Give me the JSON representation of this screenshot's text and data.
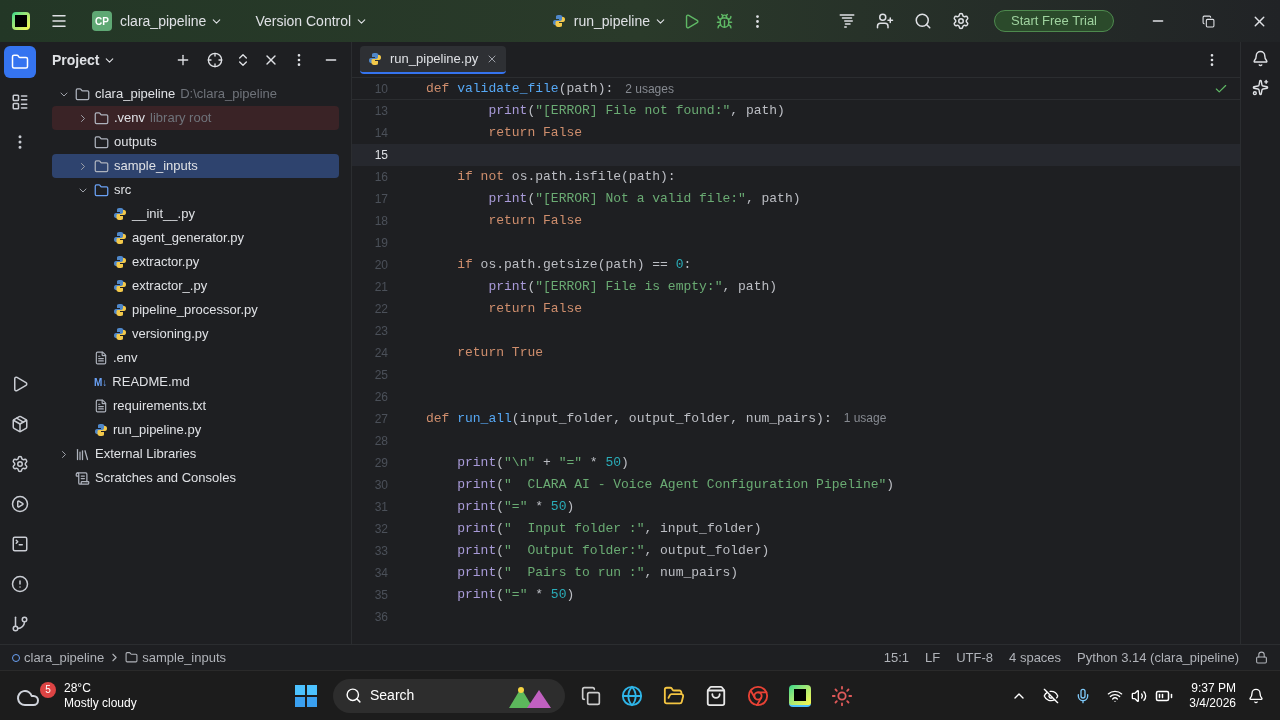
{
  "titlebar": {
    "project_badge": "CP",
    "project": "clara_pipeline",
    "vcs": "Version Control",
    "run_config": "run_pipeline",
    "trial_button": "Start Free Trial"
  },
  "project_panel": {
    "title": "Project",
    "tree": [
      {
        "name": "clara_pipeline",
        "kind": "folder",
        "hint": "D:\\clara_pipeline",
        "expanded": true,
        "selected": false,
        "children": [
          {
            "name": ".venv",
            "kind": "folder",
            "hint": "library root",
            "expanded": false,
            "selected": false,
            "excluded": true
          },
          {
            "name": "outputs",
            "kind": "folder",
            "selected": false
          },
          {
            "name": "sample_inputs",
            "kind": "folder",
            "expanded": false,
            "selected": true
          },
          {
            "name": "src",
            "kind": "source",
            "expanded": true,
            "selected": false,
            "children": [
              {
                "name": "__init__.py",
                "kind": "python",
                "selected": false
              },
              {
                "name": "agent_generator.py",
                "kind": "python",
                "selected": false
              },
              {
                "name": "extractor.py",
                "kind": "python",
                "selected": false
              },
              {
                "name": "extractor_.py",
                "kind": "python",
                "selected": false
              },
              {
                "name": "pipeline_processor.py",
                "kind": "python",
                "selected": false
              },
              {
                "name": "versioning.py",
                "kind": "python",
                "selected": false
              }
            ]
          },
          {
            "name": ".env",
            "kind": "text",
            "selected": false
          },
          {
            "name": "README.md",
            "kind": "markdown",
            "badge": "M↓",
            "selected": false
          },
          {
            "name": "requirements.txt",
            "kind": "text",
            "selected": false
          },
          {
            "name": "run_pipeline.py",
            "kind": "python",
            "selected": false
          }
        ]
      },
      {
        "name": "External Libraries",
        "kind": "library",
        "expanded": false,
        "selected": false
      },
      {
        "name": "Scratches and Consoles",
        "kind": "scratches",
        "selected": false
      }
    ]
  },
  "editor": {
    "tabs": [
      {
        "label": "run_pipeline.py",
        "selected": true
      }
    ],
    "sticky": {
      "number": "10",
      "tokens": [
        {
          "kind": "kw",
          "text": "def "
        },
        {
          "kind": "fn",
          "text": "validate_file"
        },
        {
          "kind": "plain",
          "text": "(path):"
        }
      ],
      "hint": "2 usages"
    },
    "lines": [
      {
        "number": "13",
        "current": false,
        "tokens": [
          {
            "kind": "call",
            "text": "        print"
          },
          {
            "kind": "plain",
            "text": "("
          },
          {
            "kind": "str",
            "text": "\"[ERROR] File not found:\""
          },
          {
            "kind": "plain",
            "text": ", path)"
          }
        ]
      },
      {
        "number": "14",
        "current": false,
        "tokens": [
          {
            "kind": "kw",
            "text": "        return "
          },
          {
            "kind": "kw",
            "text": "False"
          }
        ]
      },
      {
        "number": "15",
        "current": true
      },
      {
        "number": "16",
        "current": false,
        "tokens": [
          {
            "kind": "kw",
            "text": "    if not "
          },
          {
            "kind": "plain",
            "text": "os.path.isfile(path):"
          }
        ]
      },
      {
        "number": "17",
        "current": false,
        "tokens": [
          {
            "kind": "call",
            "text": "        print"
          },
          {
            "kind": "plain",
            "text": "("
          },
          {
            "kind": "str",
            "text": "\"[ERROR] Not a valid file:\""
          },
          {
            "kind": "plain",
            "text": ", path)"
          }
        ]
      },
      {
        "number": "18",
        "current": false,
        "tokens": [
          {
            "kind": "kw",
            "text": "        return "
          },
          {
            "kind": "kw",
            "text": "False"
          }
        ]
      },
      {
        "number": "19",
        "current": false
      },
      {
        "number": "20",
        "current": false,
        "tokens": [
          {
            "kind": "kw",
            "text": "    if "
          },
          {
            "kind": "plain",
            "text": "os.path.getsize(path) == "
          },
          {
            "kind": "num",
            "text": "0"
          },
          {
            "kind": "plain",
            "text": ":"
          }
        ]
      },
      {
        "number": "21",
        "current": false,
        "tokens": [
          {
            "kind": "call",
            "text": "        print"
          },
          {
            "kind": "plain",
            "text": "("
          },
          {
            "kind": "str",
            "text": "\"[ERROR] File is empty:\""
          },
          {
            "kind": "plain",
            "text": ", path)"
          }
        ]
      },
      {
        "number": "22",
        "current": false,
        "tokens": [
          {
            "kind": "kw",
            "text": "        return "
          },
          {
            "kind": "kw",
            "text": "False"
          }
        ]
      },
      {
        "number": "23",
        "current": false
      },
      {
        "number": "24",
        "current": false,
        "tokens": [
          {
            "kind": "kw",
            "text": "    return "
          },
          {
            "kind": "kw",
            "text": "True"
          }
        ]
      },
      {
        "number": "25",
        "current": false
      },
      {
        "number": "26",
        "current": false
      },
      {
        "number": "27",
        "current": false,
        "tokens": [
          {
            "kind": "kw",
            "text": "def "
          },
          {
            "kind": "fn",
            "text": "run_all"
          },
          {
            "kind": "plain",
            "text": "(input_folder, output_folder, num_pairs):"
          },
          {
            "kind": "hint",
            "text": "1 usage"
          }
        ]
      },
      {
        "number": "28",
        "current": false
      },
      {
        "number": "29",
        "current": false,
        "tokens": [
          {
            "kind": "call",
            "text": "    print"
          },
          {
            "kind": "plain",
            "text": "("
          },
          {
            "kind": "str",
            "text": "\"\\n\""
          },
          {
            "kind": "plain",
            "text": " + "
          },
          {
            "kind": "str",
            "text": "\"=\""
          },
          {
            "kind": "plain",
            "text": " * "
          },
          {
            "kind": "num",
            "text": "50"
          },
          {
            "kind": "plain",
            "text": ")"
          }
        ]
      },
      {
        "number": "30",
        "current": false,
        "tokens": [
          {
            "kind": "call",
            "text": "    print"
          },
          {
            "kind": "plain",
            "text": "("
          },
          {
            "kind": "str",
            "text": "\"  CLARA AI - Voice Agent Configuration Pipeline\""
          },
          {
            "kind": "plain",
            "text": ")"
          }
        ]
      },
      {
        "number": "31",
        "current": false,
        "tokens": [
          {
            "kind": "call",
            "text": "    print"
          },
          {
            "kind": "plain",
            "text": "("
          },
          {
            "kind": "str",
            "text": "\"=\""
          },
          {
            "kind": "plain",
            "text": " * "
          },
          {
            "kind": "num",
            "text": "50"
          },
          {
            "kind": "plain",
            "text": ")"
          }
        ]
      },
      {
        "number": "32",
        "current": false,
        "tokens": [
          {
            "kind": "call",
            "text": "    print"
          },
          {
            "kind": "plain",
            "text": "("
          },
          {
            "kind": "str",
            "text": "\"  Input folder :\""
          },
          {
            "kind": "plain",
            "text": ", input_folder)"
          }
        ]
      },
      {
        "number": "33",
        "current": false,
        "tokens": [
          {
            "kind": "call",
            "text": "    print"
          },
          {
            "kind": "plain",
            "text": "("
          },
          {
            "kind": "str",
            "text": "\"  Output folder:\""
          },
          {
            "kind": "plain",
            "text": ", output_folder)"
          }
        ]
      },
      {
        "number": "34",
        "current": false,
        "tokens": [
          {
            "kind": "call",
            "text": "    print"
          },
          {
            "kind": "plain",
            "text": "("
          },
          {
            "kind": "str",
            "text": "\"  Pairs to run :\""
          },
          {
            "kind": "plain",
            "text": ", num_pairs)"
          }
        ]
      },
      {
        "number": "35",
        "current": false,
        "tokens": [
          {
            "kind": "call",
            "text": "    print"
          },
          {
            "kind": "plain",
            "text": "("
          },
          {
            "kind": "str",
            "text": "\"=\""
          },
          {
            "kind": "plain",
            "text": " * "
          },
          {
            "kind": "num",
            "text": "50"
          },
          {
            "kind": "plain",
            "text": ")"
          }
        ]
      },
      {
        "number": "36",
        "current": false
      }
    ]
  },
  "status_bar": {
    "breadcrumbs": [
      "clara_pipeline",
      "sample_inputs"
    ],
    "items": [
      "15:1",
      "LF",
      "UTF-8",
      "4 spaces",
      "Python 3.14 (clara_pipeline)"
    ]
  },
  "taskbar": {
    "weather": {
      "badge": "5",
      "temperature": "28°C",
      "condition": "Mostly cloudy"
    },
    "search": "Search",
    "time": "9:37 PM",
    "date": "3/4/2026"
  }
}
